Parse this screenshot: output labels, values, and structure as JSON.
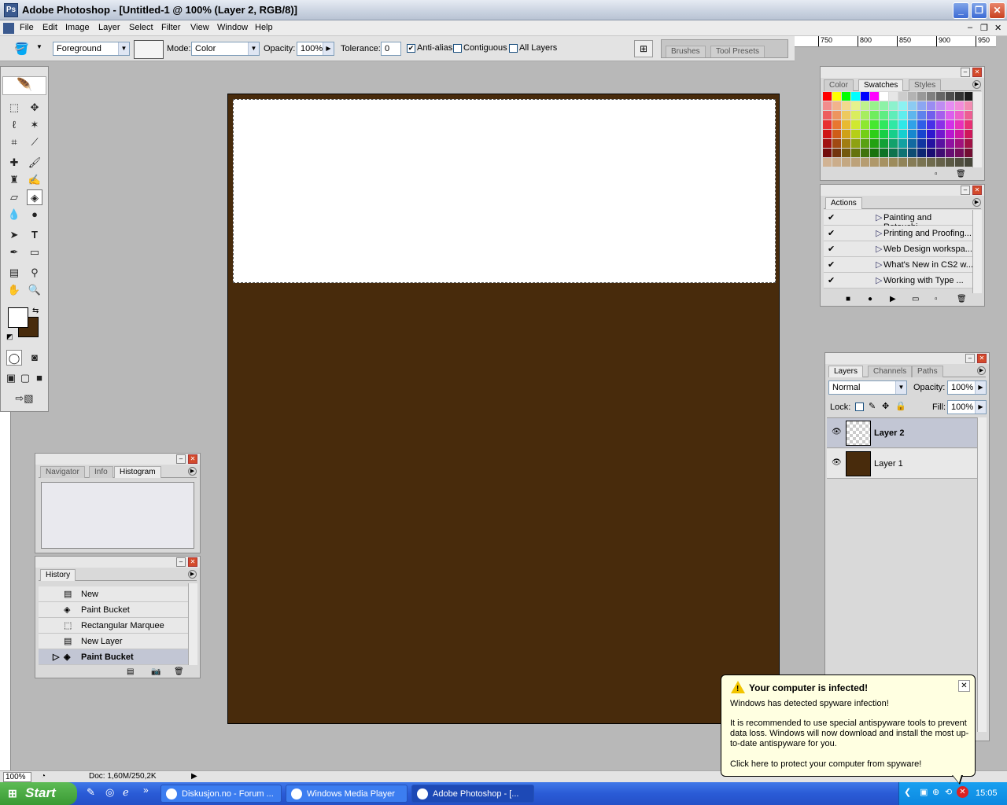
{
  "window": {
    "title": "Adobe Photoshop - [Untitled-1 @ 100% (Layer 2, RGB/8)]"
  },
  "menu": [
    "File",
    "Edit",
    "Image",
    "Layer",
    "Select",
    "Filter",
    "View",
    "Window",
    "Help"
  ],
  "options": {
    "fill_source": "Foreground",
    "mode_label": "Mode:",
    "mode_value": "Color",
    "opacity_label": "Opacity:",
    "opacity_value": "100%",
    "tolerance_label": "Tolerance:",
    "tolerance_value": "0",
    "antialias_label": "Anti-alias",
    "antialias_checked": true,
    "contiguous_label": "Contiguous",
    "contiguous_checked": false,
    "all_layers_label": "All Layers",
    "all_layers_checked": false,
    "brushes_tab": "Brushes",
    "tool_presets_tab": "Tool Presets"
  },
  "ruler_ticks": [
    "750",
    "800",
    "850",
    "900",
    "950"
  ],
  "colors": {
    "foreground": "#ffffff",
    "background": "#482b0c",
    "canvas_fill": "#482b0c",
    "white_rect": "#ffffff"
  },
  "swatches_panel": {
    "tabs": [
      "Color",
      "Swatches",
      "Styles"
    ],
    "active_tab": "Swatches"
  },
  "actions_panel": {
    "tab": "Actions",
    "items": [
      "Painting and Retouchi...",
      "Printing and Proofing...",
      "Web Design workspa...",
      "What's New in CS2 w...",
      "Working with Type ..."
    ]
  },
  "layers_panel": {
    "tabs": [
      "Layers",
      "Channels",
      "Paths"
    ],
    "blend_mode": "Normal",
    "opacity_label": "Opacity:",
    "opacity_value": "100%",
    "lock_label": "Lock:",
    "fill_label": "Fill:",
    "fill_value": "100%",
    "layers": [
      {
        "name": "Layer 2",
        "selected": true
      },
      {
        "name": "Layer 1",
        "selected": false
      }
    ]
  },
  "navigator_panel": {
    "tabs": [
      "Navigator",
      "Info",
      "Histogram"
    ],
    "active_tab": "Histogram"
  },
  "history_panel": {
    "tab": "History",
    "items": [
      "New",
      "Paint Bucket",
      "Rectangular Marquee",
      "New Layer",
      "Paint Bucket"
    ],
    "active_index": 4
  },
  "status": {
    "zoom": "100%",
    "doc": "Doc: 1,60M/250,2K"
  },
  "taskbar": {
    "start": "Start",
    "tasks": [
      "Diskusjon.no - Forum ...",
      "Windows Media Player",
      "Adobe Photoshop - [..."
    ],
    "active_task": 2,
    "clock": "15:05"
  },
  "balloon": {
    "title": "Your computer is infected!",
    "line1": "Windows has detected spyware infection!",
    "line2": "It is recommended to use special antispyware tools to prevent data loss. Windows will now download and install the most up-to-date antispyware for you.",
    "line3": "Click here to protect your computer from spyware!"
  }
}
